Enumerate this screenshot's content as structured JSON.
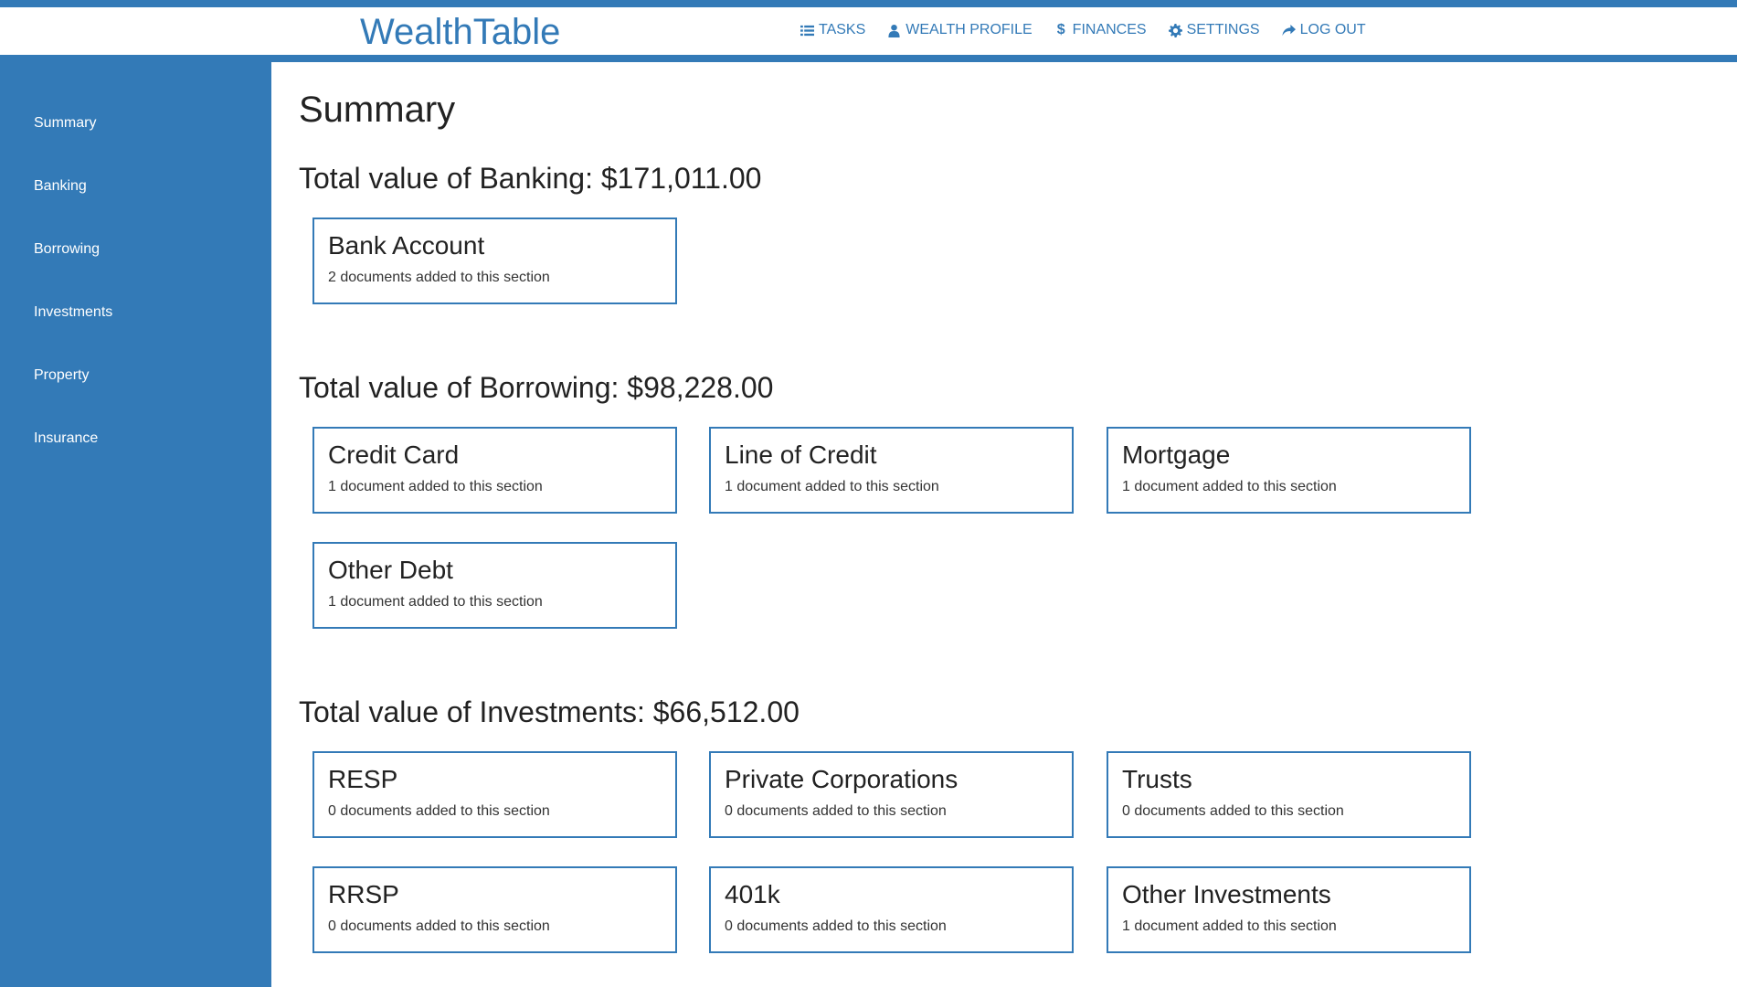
{
  "brand": "WealthTable",
  "nav": [
    {
      "label": "TASKS",
      "icon": "list-icon"
    },
    {
      "label": "WEALTH PROFILE",
      "icon": "user-icon"
    },
    {
      "label": "FINANCES",
      "icon": "dollar-icon"
    },
    {
      "label": "SETTINGS",
      "icon": "gear-icon"
    },
    {
      "label": "LOG OUT",
      "icon": "share-icon"
    }
  ],
  "sidebar": {
    "items": [
      {
        "label": "Summary"
      },
      {
        "label": "Banking"
      },
      {
        "label": "Borrowing"
      },
      {
        "label": "Investments"
      },
      {
        "label": "Property"
      },
      {
        "label": "Insurance"
      }
    ]
  },
  "main": {
    "title": "Summary",
    "sections": [
      {
        "title": "Total value of Banking: $171,011.00",
        "cards": [
          {
            "title": "Bank Account",
            "subtitle": "2 documents added to this section"
          }
        ]
      },
      {
        "title": "Total value of Borrowing: $98,228.00",
        "cards": [
          {
            "title": "Credit Card",
            "subtitle": "1 document added to this section"
          },
          {
            "title": "Line of Credit",
            "subtitle": "1 document added to this section"
          },
          {
            "title": "Mortgage",
            "subtitle": "1 document added to this section"
          },
          {
            "title": "Other Debt",
            "subtitle": "1 document added to this section"
          }
        ]
      },
      {
        "title": "Total value of Investments: $66,512.00",
        "cards": [
          {
            "title": "RESP",
            "subtitle": "0 documents added to this section"
          },
          {
            "title": "Private Corporations",
            "subtitle": "0 documents added to this section"
          },
          {
            "title": "Trusts",
            "subtitle": "0 documents added to this section"
          },
          {
            "title": "RRSP",
            "subtitle": "0 documents added to this section"
          },
          {
            "title": "401k",
            "subtitle": "0 documents added to this section"
          },
          {
            "title": "Other Investments",
            "subtitle": "1 document added to this section"
          }
        ]
      }
    ]
  },
  "colors": {
    "accent": "#337ab7",
    "text": "#222222",
    "background": "#ffffff"
  }
}
